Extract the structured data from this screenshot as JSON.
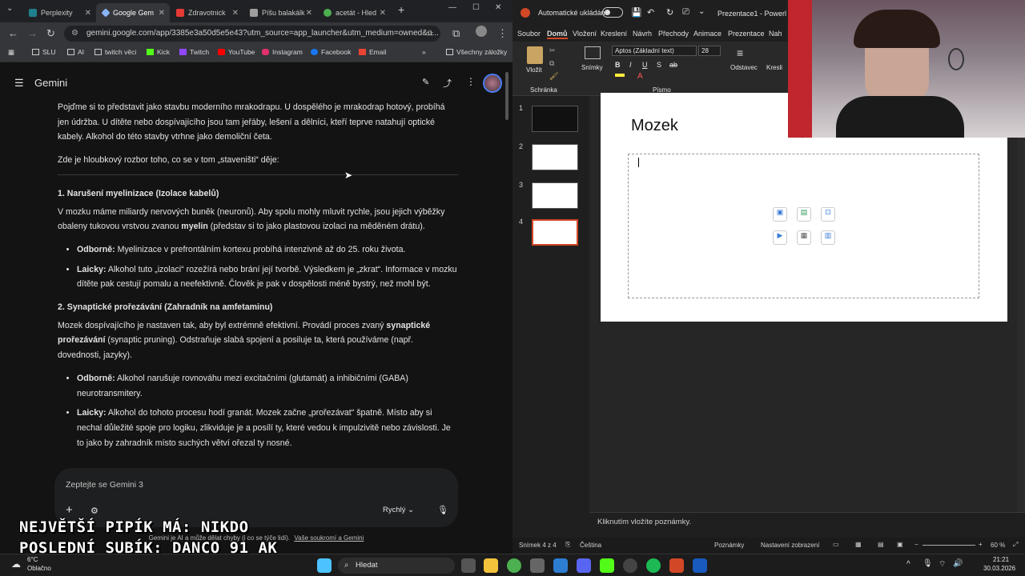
{
  "chrome": {
    "tabs": [
      {
        "label": "Perplexity",
        "color": "#20808d"
      },
      {
        "label": "Google Gem",
        "color": "#8ab4f8"
      },
      {
        "label": "Zdravotnick",
        "color": "#e53935"
      },
      {
        "label": "Píšu balakálk",
        "color": "#9e9e9e"
      },
      {
        "label": "acetát - Hled",
        "color": "#4caf50"
      }
    ],
    "url": "gemini.google.com/app/3385e3a50d5e5e43?utm_source=app_launcher&utm_medium=owned&u...",
    "bookmarks": [
      "SLU",
      "AI",
      "twitch věci",
      "Kick",
      "Twitch",
      "YouTube",
      "Instagram",
      "Facebook",
      "Email"
    ],
    "all_bookmarks": "Všechny záložky"
  },
  "gemini": {
    "title": "Gemini",
    "intro1": "Pojďme si to představit jako stavbu moderního mrakodrapu. U dospělého je mrakodrap hotový, probíhá jen údržba. U dítěte nebo dospívajícího jsou tam jeřáby, lešení a dělníci, kteří teprve natahují optické kabely. Alkohol do této stavby vtrhne jako demoliční četa.",
    "intro2": "Zde je hloubkový rozbor toho, co se v tom „staveništi“ děje:",
    "s1_title": "1. Narušení myelinizace (Izolace kabelů)",
    "s1_text_a": "V mozku máme miliardy nervových buněk (neuronů). Aby spolu mohly mluvit rychle, jsou jejich výběžky obaleny tukovou vrstvou zvanou ",
    "s1_text_b": "myelin",
    "s1_text_c": " (představ si to jako plastovou izolaci na měděném drátu).",
    "s1_b1_label": "Odborně:",
    "s1_b1_text": " Myelinizace v prefrontálním kortexu probíhá intenzivně až do 25. roku života.",
    "s1_b2_label": "Laicky:",
    "s1_b2_text": " Alkohol tuto „izolaci“ rozežírá nebo brání její tvorbě. Výsledkem je „zkrat“. Informace v mozku dítěte pak cestují pomalu a neefektivně. Člověk je pak v dospělosti méně bystrý, než mohl být.",
    "s2_title": "2. Synaptické prořezávání (Zahradník na amfetaminu)",
    "s2_text_a": "Mozek dospívajícího je nastaven tak, aby byl extrémně efektivní. Provádí proces zvaný ",
    "s2_text_b": "synaptické prořezávání",
    "s2_text_c": " (synaptic pruning). Odstraňuje slabá spojení a posiluje ta, která používáme (např. dovednosti, jazyky).",
    "s2_b1_label": "Odborně:",
    "s2_b1_text": " Alkohol narušuje rovnováhu mezi excitačními (glutamát) a inhibičními (GABA) neurotransmitery.",
    "s2_b2_label": "Laicky:",
    "s2_b2_text": " Alkohol do tohoto procesu hodí granát. Mozek začne „prořezávat“ špatně. Místo aby si nechal důležité spoje pro logiku, zlikviduje je a posílí ty, které vedou k impulzivitě nebo závislosti. Je to jako by zahradník místo suchých větví ořezal ty nosné.",
    "prompt_placeholder": "Zeptejte se Gemini 3",
    "mode": "Rychlý",
    "disclaimer": "Gemini je AI a může dělat chyby (i co se týče lidí).",
    "disclaimer_link": "Vaše soukromí a Gemini"
  },
  "ppt": {
    "autosave": "Automatické ukládání",
    "filename": "Prezentace1 - Powerl",
    "tabs": [
      "Soubor",
      "Domů",
      "Vložení",
      "Kreslení",
      "Návrh",
      "Přechody",
      "Animace",
      "Prezentace",
      "Nah"
    ],
    "active_tab": "Domů",
    "font_name": "Aptos (Základní text)",
    "font_size": "28",
    "group_clipboard": "Schránka",
    "group_font": "Písmo",
    "btn_paste": "Vložit",
    "btn_slides": "Snímky",
    "btn_paragraph": "Odstavec",
    "btn_draw": "Kresli",
    "slide_numbers": [
      "1",
      "2",
      "3",
      "4"
    ],
    "slide_title": "Mozek",
    "notes_placeholder": "Kliknutím vložíte poznámky.",
    "status_slide": "Snímek 4 z 4",
    "status_lang": "Čeština",
    "status_notes": "Poznámky",
    "status_view": "Nastavení zobrazení",
    "zoom": "60 %"
  },
  "overlay": {
    "line1": "NEJVĚTŠÍ PIPÍK MÁ: NIKDO",
    "line2": "POSLEDNÍ SUBÍK: DANCO_91_AK"
  },
  "taskbar": {
    "weather_temp": "6°C",
    "weather_text": "Oblačno",
    "search": "Hledat",
    "time": "21:21",
    "date": "30.03.2026"
  }
}
